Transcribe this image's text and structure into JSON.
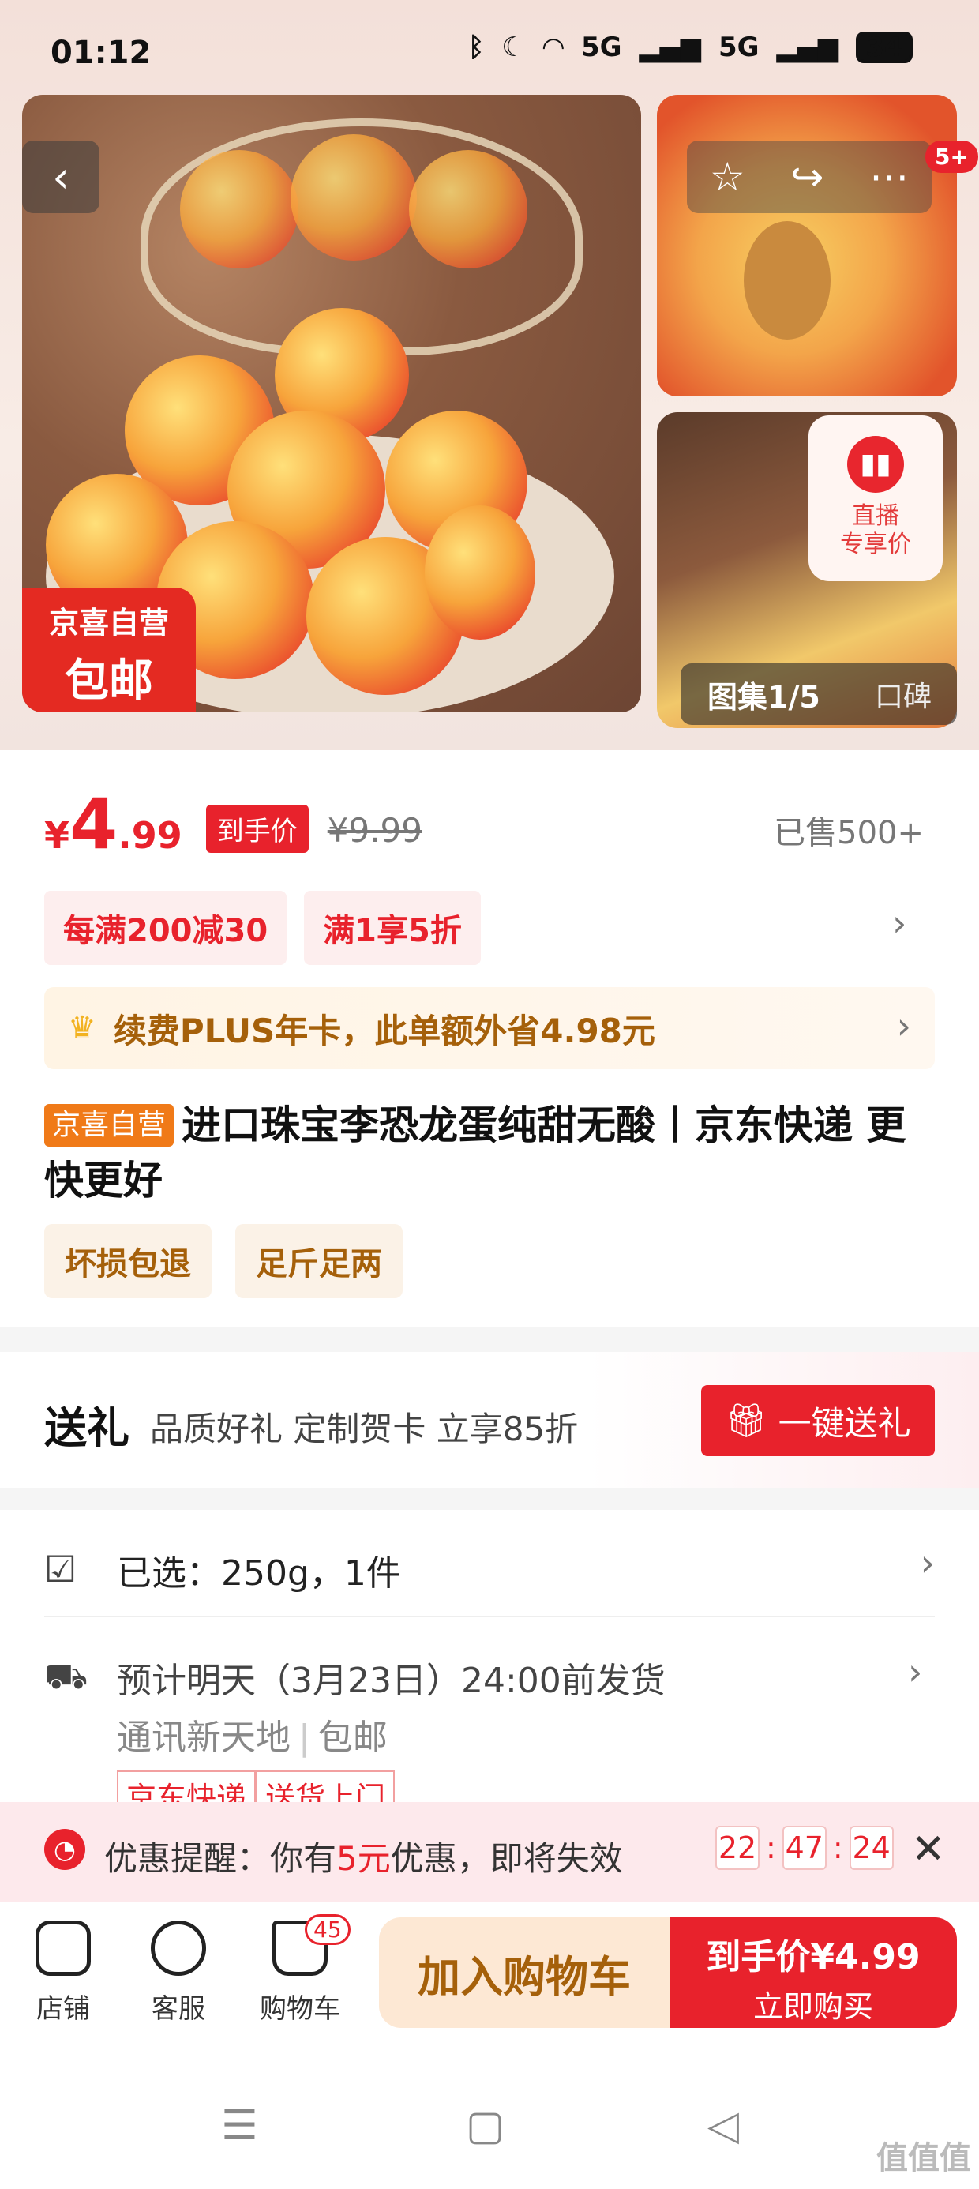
{
  "status_bar": {
    "time": "01:12",
    "network_1": "5G",
    "network_2": "5G",
    "battery": "34"
  },
  "gallery": {
    "badge_line1": "京喜自营",
    "badge_line2": "包邮",
    "live_line1": "直播",
    "live_line2": "专享价",
    "counter": "图集1/5",
    "reviews_tab": "口碑",
    "notify_count": "5+"
  },
  "product": {
    "price_symbol": "¥",
    "price_int": "4",
    "price_dec": ".99",
    "price_tag": "到手价",
    "original_price": "¥9.99",
    "sold": "已售500+",
    "promos": [
      "每满200减30",
      "满1享5折"
    ],
    "plus_text": "续费PLUS年卡，此单额外省4.98元",
    "title_tag": "京喜自营",
    "title": "进口珠宝李恐龙蛋纯甜无酸丨京东快递 更快更好",
    "services": [
      "坏损包退",
      "足斤足两"
    ]
  },
  "gift": {
    "title": "送礼",
    "desc": "品质好礼 定制贺卡 立享85折",
    "button": "一键送礼"
  },
  "selection": {
    "selected": "已选：250g，1件",
    "ship_line1": "预计明天（3月23日）24:00前发货",
    "ship_origin": "通讯新天地",
    "ship_free": "包邮",
    "ship_tag1": "京东快递",
    "ship_tag2": "送货上门"
  },
  "alert": {
    "prefix": "优惠提醒：你有",
    "amount": "5元",
    "suffix": "优惠，即将失效",
    "timer_h": "22",
    "timer_m": "47",
    "timer_s": "24"
  },
  "actionbar": {
    "shop": "店铺",
    "service": "客服",
    "cart": "购物车",
    "cart_count": "45",
    "add_cart": "加入购物车",
    "buy_line1": "到手价¥4.99",
    "buy_line2": "立即购买"
  },
  "watermark": "值值值"
}
